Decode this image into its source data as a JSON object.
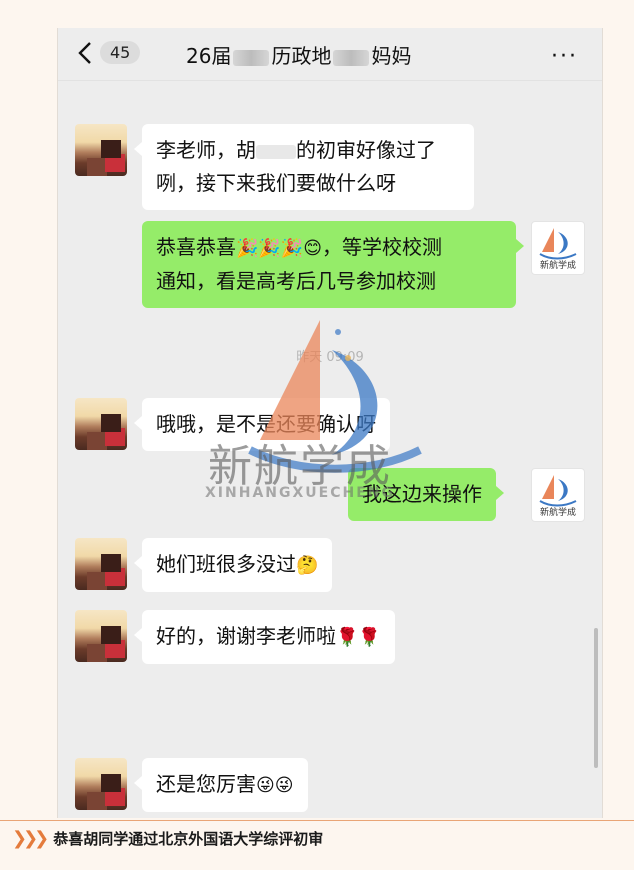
{
  "header": {
    "unread_count": "45",
    "title_part1": "26届",
    "title_part2": "历政地",
    "title_part3": "妈妈",
    "more_label": "···"
  },
  "timestamps": [
    "昨天 09:09",
    "昨天 09:09"
  ],
  "messages": [
    {
      "side": "left",
      "text_line1": "李老师，胡",
      "text_line1b": "的初审好像过了",
      "text_line2": "咧，接下来我们要做什么呀"
    },
    {
      "side": "right",
      "text_line1": "恭喜恭喜",
      "text_line1b": "，等学校校测",
      "text_line2": "通知，看是高考后几号参加校测"
    },
    {
      "side": "left",
      "text": "哦哦，是不是还要确认呀"
    },
    {
      "side": "right",
      "text": "我这边来操作"
    },
    {
      "side": "left",
      "text": "她们班很多没过"
    },
    {
      "side": "left",
      "text": "好的，谢谢李老师啦"
    },
    {
      "side": "left",
      "text": "还是您厉害"
    }
  ],
  "emoji": {
    "party": "🎉",
    "smile": "😊",
    "think": "🤔",
    "rose": "🌹",
    "tongue": "😜"
  },
  "brand": {
    "name": "新航学成",
    "name_en": "XINHANGXUECHENG",
    "avatar_caption": "新航学成"
  },
  "caption": {
    "text": "恭喜胡同学通过北京外国语大学综评初审"
  },
  "colors": {
    "bubble_right": "#95ec69",
    "bubble_left": "#ffffff",
    "chat_bg": "#ededed",
    "accent_orange": "#e47b3c",
    "logo_blue": "#3b78c4"
  }
}
